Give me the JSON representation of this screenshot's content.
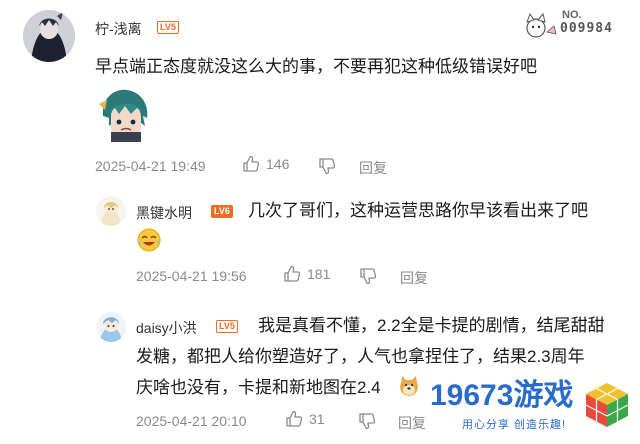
{
  "comment": {
    "username": "柠-浅离",
    "level": "LV5",
    "text": "早点端正态度就没这么大的事，不要再犯这种低级错误好吧",
    "timestamp": "2025-04-21 19:49",
    "likes": "146",
    "reply_label": "回复",
    "badge_no": "NO.",
    "badge_number": "009984"
  },
  "replies": [
    {
      "username": "黑键水明",
      "level": "LV6",
      "text": "几次了哥们，这种运营思路你早该看出来了吧",
      "timestamp": "2025-04-21 19:56",
      "likes": "181",
      "reply_label": "回复"
    },
    {
      "username": "daisy小洪",
      "level": "LV5",
      "text_line1": "我是真看不懂，2.2全是卡提的剧情，结尾甜甜",
      "text_line2": "发糖，都把人给你塑造好了，人气也拿捏住了，结果2.3周年",
      "text_line3": "庆啥也没有，卡提和新地图在2.4",
      "timestamp": "2025-04-21 20:10",
      "likes": "31",
      "reply_label": "回复"
    }
  ],
  "watermark": {
    "brand_number": "19673",
    "brand_text": "游戏",
    "slogan": "用心分享 创造乐趣!"
  },
  "colors": {
    "level_orange": "#f26b22",
    "meta_gray": "#8a8a8a",
    "brand_blue": "#2a6cc9"
  }
}
